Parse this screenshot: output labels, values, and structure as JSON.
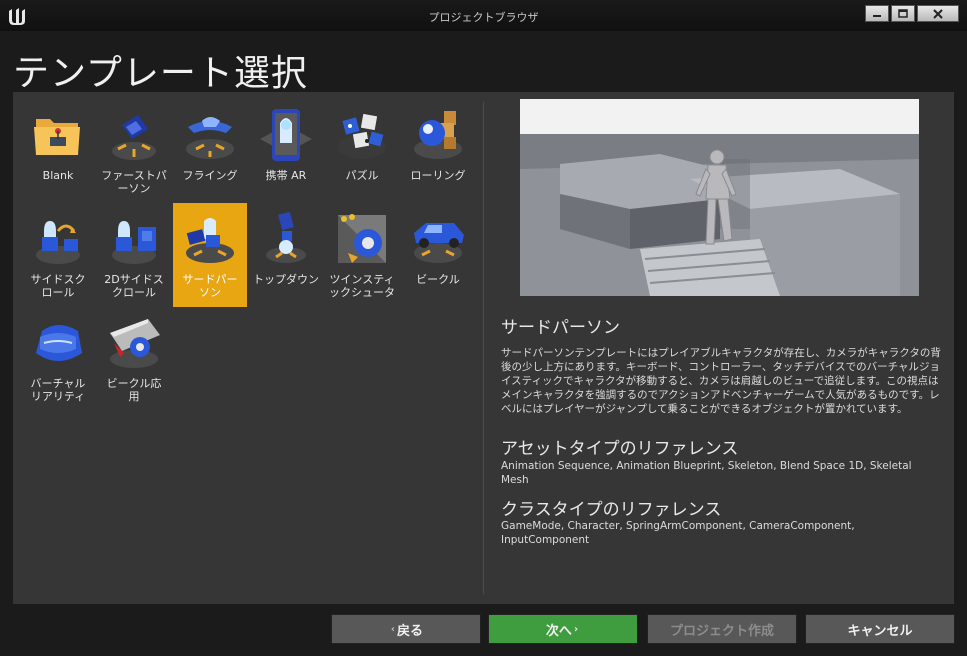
{
  "window": {
    "title": "プロジェクトブラウザ"
  },
  "dialog": {
    "title": "テンプレート選択"
  },
  "templates": [
    {
      "label": "Blank"
    },
    {
      "label": "ファーストパ\nーソン"
    },
    {
      "label": "フライング"
    },
    {
      "label": "携帯 AR"
    },
    {
      "label": "パズル"
    },
    {
      "label": "ローリング"
    },
    {
      "label": "サイドスク\nロール"
    },
    {
      "label": "2Dサイドス\nクロール"
    },
    {
      "label": "サードパー\nソン"
    },
    {
      "label": "トップダウン"
    },
    {
      "label": "ツインスティ\nックシュータ"
    },
    {
      "label": "ビークル"
    },
    {
      "label": "バーチャル\nリアリティ"
    },
    {
      "label": "ビークル応\n用"
    }
  ],
  "selected_template": "サードパーソン",
  "description": {
    "title": "サードパーソン",
    "body": "サードパーソンテンプレートにはプレイアブルキャラクタが存在し、カメラがキャラクタの背後の少し上方にあります。キーボード、コントローラー、タッチデバイスでのバーチャルジョイスティックでキャラクタが移動すると、カメラは肩越しのビューで追従します。この視点はメインキャラクタを強調するのでアクションアドベンチャーゲームで人気があるものです。レベルにはプレイヤーがジャンプして乗ることができるオブジェクトが置かれています。",
    "asset_title": "アセットタイプのリファレンス",
    "asset_body": "Animation Sequence, Animation Blueprint, Skeleton, Blend Space 1D, Skeletal Mesh",
    "class_title": "クラスタイプのリファレンス",
    "class_body": "GameMode, Character, SpringArmComponent, CameraComponent, InputComponent"
  },
  "buttons": {
    "back": "戻る",
    "next": "次へ",
    "create": "プロジェクト作成",
    "cancel": "キャンセル"
  },
  "colors": {
    "selected": "#e8a613",
    "next_button": "#3f9c3f"
  }
}
